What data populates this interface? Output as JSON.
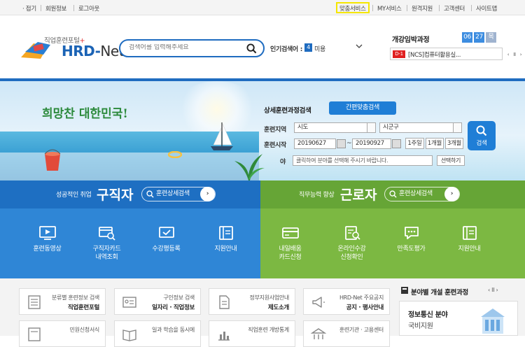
{
  "util": {
    "left": [
      "· 접기",
      "회원정보",
      "로그아웃"
    ],
    "right": [
      "맞춤서비스",
      "MY서비스",
      "원격지원",
      "고객센터",
      "사이트맵"
    ]
  },
  "logo": {
    "sub": "직업훈련포털",
    "star": "+",
    "main": "HRD-",
    "net": "Net"
  },
  "search": {
    "placeholder": "검색어를 입력해주세요"
  },
  "popular": {
    "label": "인기검색어 :",
    "rank": "4",
    "term": "미용"
  },
  "announce": {
    "title": "개강임박과정",
    "month": "06",
    "day": "27",
    "weekday": "목",
    "dday": "D-1",
    "item": "[NCS]컴퓨터활용실...",
    "controls": [
      "‹",
      "II",
      "›"
    ]
  },
  "hero": {
    "slogan": "희망찬 대한민국!"
  },
  "search_panel": {
    "title": "상세훈련과정검색",
    "quick_button": "간편맞춤검색",
    "region_label": "훈련지역",
    "region_city": "시도",
    "region_district": "시군구",
    "start_label": "훈련시작",
    "date_from": "20190627",
    "tilde": "~",
    "date_to": "20190927",
    "periods": [
      "1주일",
      "1개월",
      "3개월"
    ],
    "field_label": "야",
    "field_placeholder": "클릭하여 분야를 선택해 주시기 바랍니다.",
    "field_button": "선택하기",
    "search_button": "검색"
  },
  "job": {
    "sub": "성공적인 취업",
    "main": "구직자",
    "pill": "훈련상세검색"
  },
  "worker": {
    "sub": "직무능력 향상",
    "main": "근로자",
    "pill": "훈련상세검색"
  },
  "job_tiles": [
    {
      "l1": "훈련동영상",
      "l2": ""
    },
    {
      "l1": "구직자카드",
      "l2": "내역조회"
    },
    {
      "l1": "수강평등록",
      "l2": ""
    },
    {
      "l1": "지원안내",
      "l2": ""
    }
  ],
  "worker_tiles": [
    {
      "l1": "내일배움",
      "l2": "카드신청"
    },
    {
      "l1": "온라인수강",
      "l2": "신청확인"
    },
    {
      "l1": "만족도평가",
      "l2": ""
    },
    {
      "l1": "지원안내",
      "l2": ""
    }
  ],
  "quick_cards": [
    {
      "l1": "분류별 훈련정보 검색",
      "l2": "직업훈련포털"
    },
    {
      "l1": "구인정보 검색",
      "l2": "일자리 · 직업정보"
    },
    {
      "l1": "정부지원사업안내",
      "l2": "제도소개"
    },
    {
      "l1": "HRD-Net 주요공지",
      "l2": "공지 · 행사안내"
    },
    {
      "l1": "민원신청서식",
      "l2": ""
    },
    {
      "l1": "일과 학습을 동시에",
      "l2": ""
    },
    {
      "l1": "직업훈련 개방통계",
      "l2": ""
    },
    {
      "l1": "훈련기관 · 고용센터",
      "l2": ""
    }
  ],
  "field_box": {
    "title": "분야별 개설 훈련과정",
    "controls": "‹ II ›",
    "line1": "정보통신 분야",
    "line2": "국비지원"
  },
  "colors": {
    "primary": "#1f6cc0",
    "job_blue": "#2f86d6",
    "worker_green": "#7cb842",
    "highlight": "#f5e600"
  }
}
